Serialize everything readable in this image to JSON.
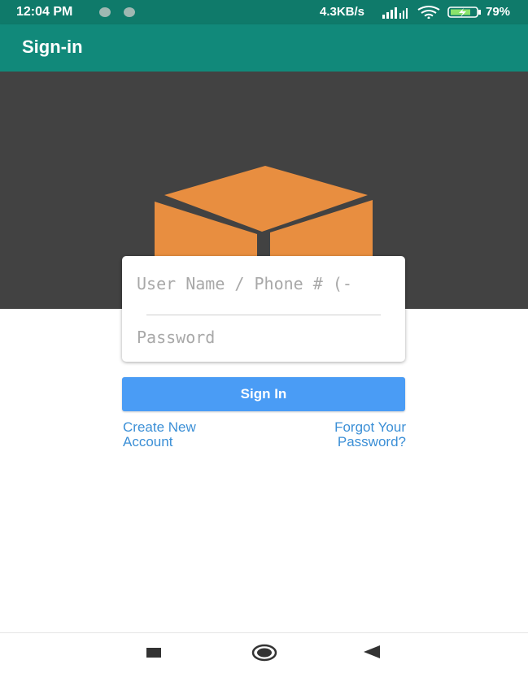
{
  "status_bar": {
    "time": "12:04 PM",
    "network_speed": "4.3KB/s",
    "battery_percent": "79%",
    "icons": [
      "notification-dot-icon",
      "notification-dot-icon",
      "signal-icon",
      "wifi-icon",
      "battery-charging-icon"
    ]
  },
  "app_bar": {
    "title": "Sign-in"
  },
  "hero": {
    "logo_icon": "box-logo-icon",
    "logo_color": "#E88E40",
    "background": "#424242"
  },
  "form": {
    "username_placeholder": "User Name / Phone # (-",
    "password_placeholder": "Password",
    "sign_in_label": "Sign In",
    "create_account_line1": "Create New",
    "create_account_line2": "Account",
    "forgot_password_line1": "Forgot Your",
    "forgot_password_line2": "Password?"
  },
  "colors": {
    "accent": "#4A9CF5",
    "app_bar": "#11897A",
    "link": "#3B8FD6"
  },
  "nav_bar": {
    "icons": [
      "recents-icon",
      "home-icon",
      "back-icon"
    ]
  }
}
